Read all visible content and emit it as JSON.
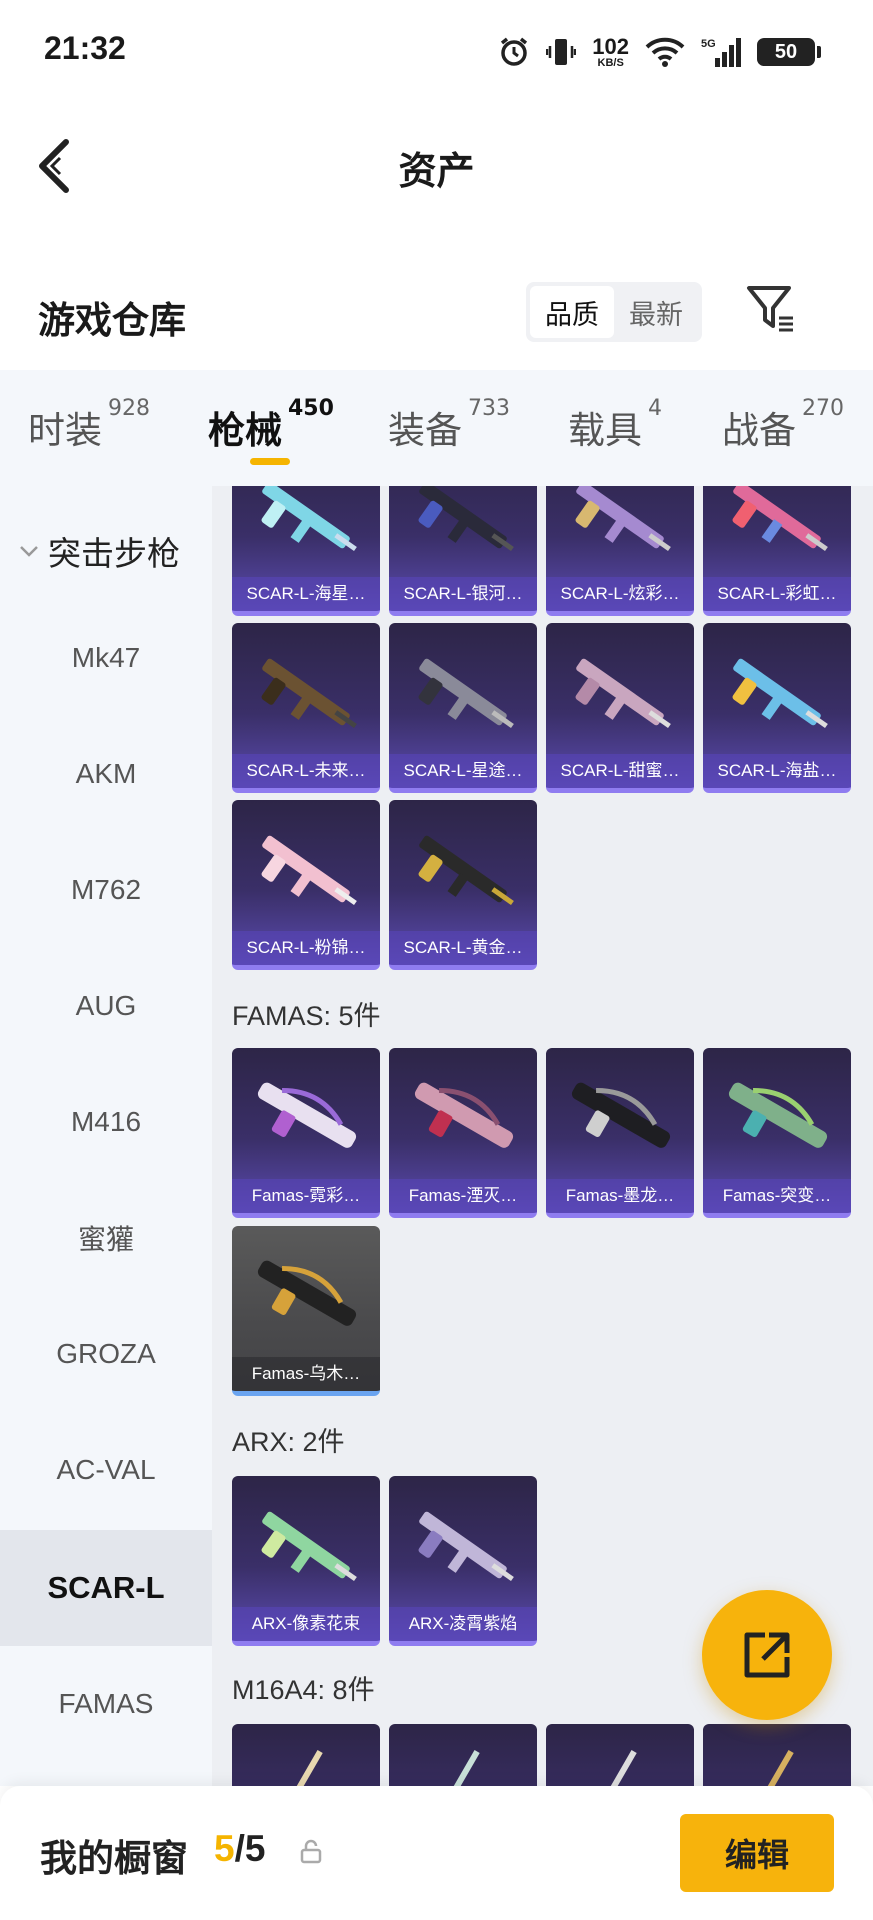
{
  "status_bar": {
    "time": "21:32",
    "net_speed_value": "102",
    "net_speed_unit": "KB/S",
    "network": "5G",
    "battery": "50",
    "icons": [
      "alarm-icon",
      "vibrate-icon",
      "wifi-icon",
      "signal-icon",
      "battery-icon"
    ]
  },
  "header": {
    "title": "资产",
    "back_icon": "back-arrow-icon"
  },
  "warehouse": {
    "title": "游戏仓库",
    "sort_options": [
      "品质",
      "最新"
    ],
    "sort_selected": "品质",
    "filter_icon": "filter-icon"
  },
  "tabs": [
    {
      "label": "时装",
      "count": "928",
      "active": false
    },
    {
      "label": "枪械",
      "count": "450",
      "active": true
    },
    {
      "label": "装备",
      "count": "733",
      "active": false
    },
    {
      "label": "载具",
      "count": "4",
      "active": false
    },
    {
      "label": "战备",
      "count": "270",
      "active": false
    }
  ],
  "sidebar": {
    "category": "突击步枪",
    "items": [
      "Mk47",
      "AKM",
      "M762",
      "AUG",
      "M416",
      "蜜獾",
      "GROZA",
      "AC-VAL",
      "SCAR-L",
      "FAMAS"
    ],
    "selected": "SCAR-L"
  },
  "sections": {
    "scar": {
      "items": [
        "SCAR-L-海星…",
        "SCAR-L-银河…",
        "SCAR-L-炫彩…",
        "SCAR-L-彩虹…",
        "SCAR-L-未来…",
        "SCAR-L-星途…",
        "SCAR-L-甜蜜…",
        "SCAR-L-海盐…",
        "SCAR-L-粉锦…",
        "SCAR-L-黄金…"
      ]
    },
    "famas": {
      "title": "FAMAS: 5件",
      "items": [
        "Famas-霓彩…",
        "Famas-湮灭…",
        "Famas-墨龙…",
        "Famas-突变…",
        "Famas-乌木…"
      ]
    },
    "arx": {
      "title": "ARX: 2件",
      "items": [
        "ARX-像素花束",
        "ARX-凌霄紫焰"
      ]
    },
    "m16": {
      "title": "M16A4: 8件"
    }
  },
  "bottom_bar": {
    "label": "我的橱窗",
    "current": "5",
    "total": "/5",
    "lock_icon": "lock-icon",
    "edit_label": "编辑"
  },
  "colors": {
    "accent": "#f7b30c",
    "card_purple": "#3a2f68",
    "card_gray": "#4a4a4c",
    "sidebar_bg": "#f4f7fb",
    "main_bg": "#edeff3"
  }
}
